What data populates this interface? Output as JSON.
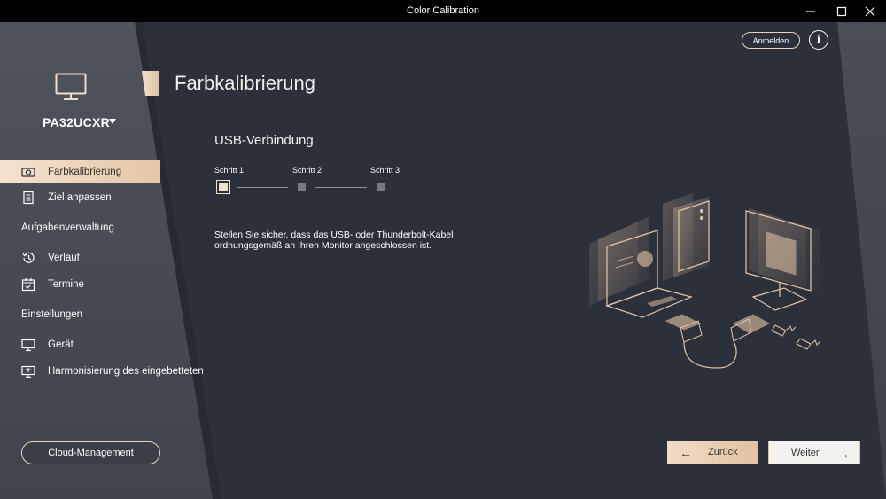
{
  "window": {
    "title": "Color Calibration"
  },
  "header": {
    "login_label": "Anmelden",
    "info_symbol": "i"
  },
  "sidebar": {
    "device_name": "PA32UCXR",
    "items": [
      {
        "label": "Farbkalibrierung",
        "icon": "camera-icon",
        "active": true
      },
      {
        "label": "Ziel anpassen",
        "icon": "document-icon"
      }
    ],
    "section_tasks": "Aufgabenverwaltung",
    "task_items": [
      {
        "label": "Verlauf",
        "icon": "history-icon"
      },
      {
        "label": "Termine",
        "icon": "calendar-icon"
      }
    ],
    "section_settings": "Einstellungen",
    "settings_items": [
      {
        "label": "Gerät",
        "icon": "monitor-icon"
      },
      {
        "label": "Harmonisierung des eingebetteten",
        "icon": "monitor-sync-icon"
      }
    ],
    "cloud_button": "Cloud-Management"
  },
  "main": {
    "page_title": "Farbkalibrierung",
    "section_title": "USB-Verbindung",
    "steps": [
      "Schritt 1",
      "Schritt 2",
      "Schritt 3"
    ],
    "current_step": 1,
    "instruction": "Stellen Sie sicher, dass das USB- oder Thunderbolt-Kabel ordnungsgemäß an Ihren Monitor angeschlossen ist."
  },
  "footer": {
    "back_label": "Zurück",
    "next_label": "Weiter"
  },
  "colors": {
    "accent": "#e6c6a6",
    "background": "#2c303a",
    "sidebar": "#4a4e57"
  }
}
